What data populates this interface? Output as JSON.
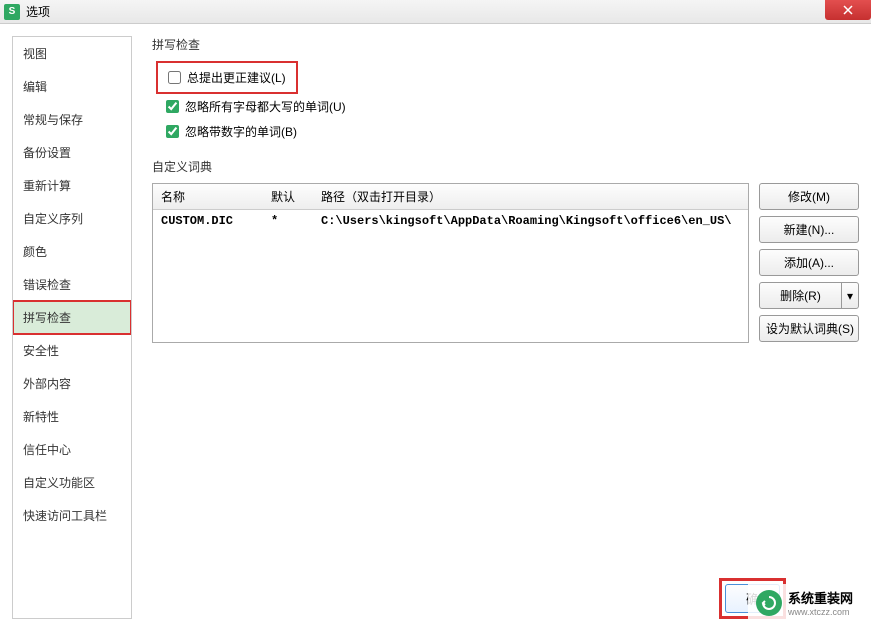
{
  "titlebar": {
    "icon_letter": "S",
    "title": "选项"
  },
  "sidebar": {
    "items": [
      {
        "label": "视图"
      },
      {
        "label": "编辑"
      },
      {
        "label": "常规与保存"
      },
      {
        "label": "备份设置"
      },
      {
        "label": "重新计算"
      },
      {
        "label": "自定义序列"
      },
      {
        "label": "颜色"
      },
      {
        "label": "错误检查"
      },
      {
        "label": "拼写检查",
        "active": true,
        "highlight": true
      },
      {
        "label": "安全性"
      },
      {
        "label": "外部内容"
      },
      {
        "label": "新特性"
      },
      {
        "label": "信任中心"
      },
      {
        "label": "自定义功能区"
      },
      {
        "label": "快速访问工具栏"
      }
    ]
  },
  "content": {
    "spellcheck_title": "拼写检查",
    "checkboxes": [
      {
        "label": "总提出更正建议(L)",
        "checked": false,
        "highlight": true
      },
      {
        "label": "忽略所有字母都大写的单词(U)",
        "checked": true
      },
      {
        "label": "忽略带数字的单词(B)",
        "checked": true
      }
    ],
    "dict_title": "自定义词典",
    "dict_headers": {
      "name": "名称",
      "default": "默认",
      "path": "路径（双击打开目录）"
    },
    "dict_rows": [
      {
        "name": "CUSTOM.DIC",
        "default": "*",
        "path": "C:\\Users\\kingsoft\\AppData\\Roaming\\Kingsoft\\office6\\en_US\\"
      }
    ],
    "dict_buttons": {
      "modify": "修改(M)",
      "new": "新建(N)...",
      "add": "添加(A)...",
      "delete": "删除(R)",
      "set_default": "设为默认词典(S)"
    }
  },
  "footer": {
    "ok": "确"
  },
  "watermark": {
    "title": "系统重装网",
    "sub": "www.xtczz.com"
  }
}
